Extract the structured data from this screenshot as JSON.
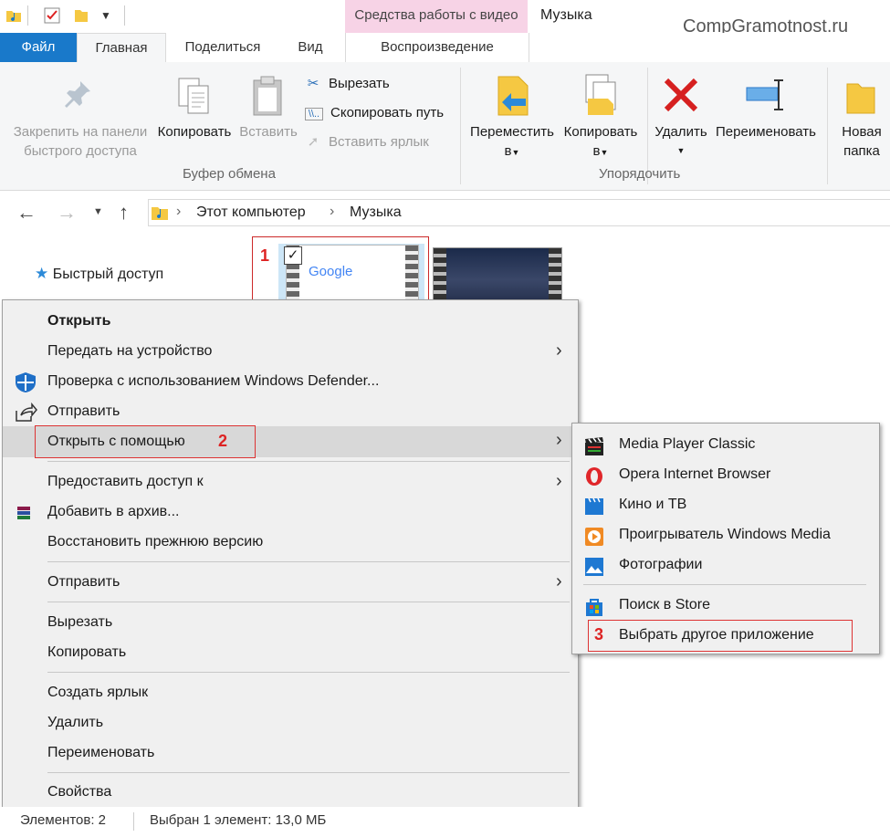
{
  "titlebar": {
    "video_tools": "Средства работы с видео",
    "window_title": "Музыка",
    "watermark": "CompGramotnost.ru"
  },
  "tabs": {
    "file": "Файл",
    "home": "Главная",
    "share": "Поделиться",
    "view": "Вид",
    "playback": "Воспроизведение"
  },
  "ribbon": {
    "pin": [
      "Закрепить на панели",
      "быстрого доступа"
    ],
    "copy": "Копировать",
    "paste": "Вставить",
    "cut": "Вырезать",
    "copy_path": "Скопировать путь",
    "paste_shortcut": "Вставить ярлык",
    "clipboard_group": "Буфер обмена",
    "move_to": [
      "Переместить",
      "в"
    ],
    "copy_to": [
      "Копировать",
      "в"
    ],
    "delete": "Удалить",
    "rename": "Переименовать",
    "organize_group": "Упорядочить",
    "new_folder": [
      "Новая",
      "папка"
    ]
  },
  "address": {
    "crumbs": [
      "Этот компьютер",
      "Музыка"
    ]
  },
  "nav": {
    "quick_access": "Быстрый доступ"
  },
  "files": {
    "thumb1_text": "Google",
    "badge1": "1"
  },
  "context_menu": {
    "items": {
      "open": "Открыть",
      "cast": "Передать на устройство",
      "defender": "Проверка с использованием Windows Defender...",
      "share": "Отправить",
      "open_with": "Открыть с помощью",
      "give_access": "Предоставить доступ к",
      "add_archive": "Добавить в архив...",
      "restore": "Восстановить прежнюю версию",
      "send_to": "Отправить",
      "cut": "Вырезать",
      "copy": "Копировать",
      "create_shortcut": "Создать ярлык",
      "delete": "Удалить",
      "rename": "Переименовать",
      "properties": "Свойства"
    },
    "badge2": "2"
  },
  "submenu": {
    "items": [
      "Media Player Classic",
      "Opera Internet Browser",
      "Кино и ТВ",
      "Проигрыватель Windows Media",
      "Фотографии"
    ],
    "store": "Поиск в Store",
    "choose_other": "Выбрать другое приложение",
    "badge3": "3"
  },
  "status": {
    "count": "Элементов: 2",
    "selected": "Выбран 1 элемент: 13,0 МБ"
  },
  "colors": {
    "file_tab": "#1979ca",
    "video_tools_bg": "#f7d3e6",
    "highlight_red": "#d22222",
    "delete_red": "#d62020",
    "folder_yellow": "#f5c842"
  }
}
